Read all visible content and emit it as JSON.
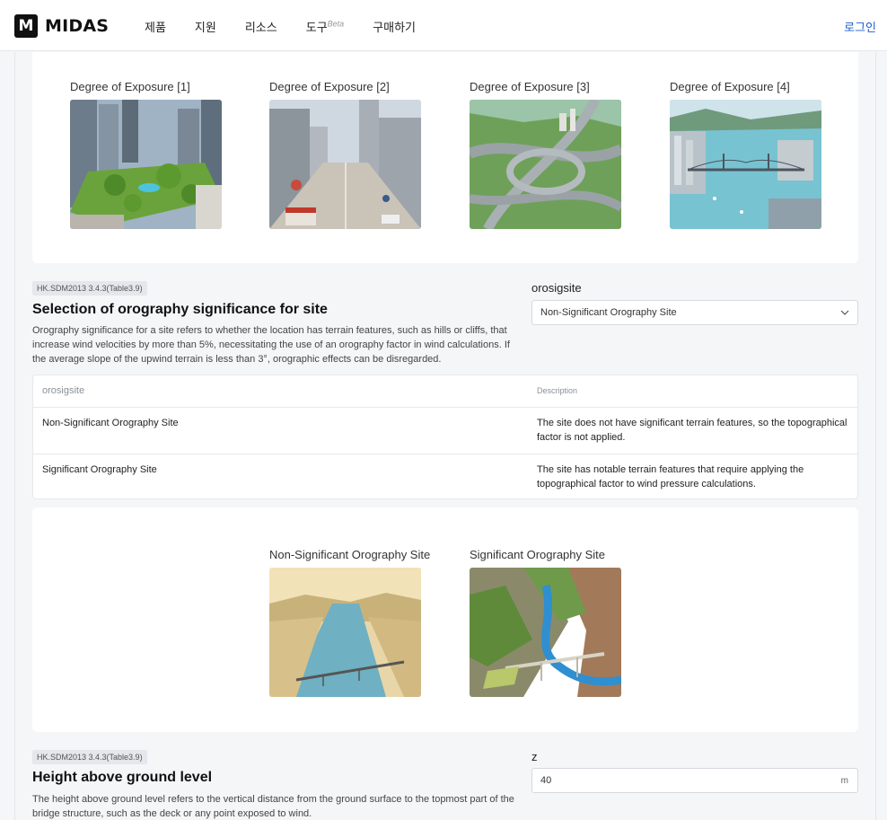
{
  "header": {
    "brand": "MIDAS",
    "brand_mark": "M",
    "nav": [
      {
        "label": "제품"
      },
      {
        "label": "지원"
      },
      {
        "label": "리소스"
      },
      {
        "label": "도구",
        "badge": "Beta"
      },
      {
        "label": "구매하기"
      }
    ],
    "login": "로그인"
  },
  "exposure_figures": [
    {
      "label": "Degree of Exposure [1]"
    },
    {
      "label": "Degree of Exposure [2]"
    },
    {
      "label": "Degree of Exposure [3]"
    },
    {
      "label": "Degree of Exposure [4]"
    }
  ],
  "orography": {
    "reference": "HK.SDM2013 3.4.3(Table3.9)",
    "title": "Selection of orography significance for site",
    "description": "Orography significance for a site refers to whether the location has terrain features, such as hills or cliffs, that increase wind velocities by more than 5%, necessitating the use of an orography factor in wind calculations. If the average slope of the upwind terrain is less than 3°, orographic effects can be disregarded.",
    "field_label": "orosigsite",
    "selected": "Non-Significant Orography Site",
    "table": {
      "headers": [
        "orosigsite",
        "Description"
      ],
      "rows": [
        {
          "name": "Non-Significant Orography Site",
          "description": "The site does not have significant terrain features, so the topographical factor is not applied."
        },
        {
          "name": "Significant Orography Site",
          "description": "The site has notable terrain features that require applying the topographical factor to wind pressure calculations."
        }
      ]
    },
    "figures": [
      {
        "label": "Non-Significant Orography Site"
      },
      {
        "label": "Significant Orography Site"
      }
    ]
  },
  "height": {
    "reference": "HK.SDM2013 3.4.3(Table3.9)",
    "title": "Height above ground level",
    "description": "The height above ground level refers to the vertical distance from the ground surface to the topmost part of the bridge structure, such as the deck or any point exposed to wind.",
    "field_label": "z",
    "value": "40",
    "unit": "m"
  },
  "icons": {
    "dropdown": "chevron-down-icon"
  },
  "colors": {
    "link": "#1a5fd0",
    "tag_bg": "#e4e7eb"
  }
}
